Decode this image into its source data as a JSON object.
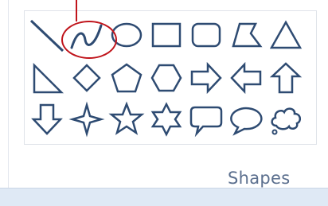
{
  "group": {
    "label": "Shapes"
  },
  "colors": {
    "stroke": "#2e4b72",
    "callout": "#c0141b",
    "label": "#5b6f8e"
  },
  "shapes": [
    {
      "name": "line",
      "selected": false
    },
    {
      "name": "curve",
      "selected": true
    },
    {
      "name": "oval",
      "selected": false
    },
    {
      "name": "rectangle",
      "selected": false
    },
    {
      "name": "rounded-rectangle",
      "selected": false
    },
    {
      "name": "polygon",
      "selected": false
    },
    {
      "name": "triangle",
      "selected": false
    },
    {
      "name": "right-triangle",
      "selected": false
    },
    {
      "name": "diamond",
      "selected": false
    },
    {
      "name": "pentagon",
      "selected": false
    },
    {
      "name": "hexagon",
      "selected": false
    },
    {
      "name": "right-arrow",
      "selected": false
    },
    {
      "name": "left-arrow",
      "selected": false
    },
    {
      "name": "up-arrow",
      "selected": false
    },
    {
      "name": "down-arrow",
      "selected": false
    },
    {
      "name": "four-point-star",
      "selected": false
    },
    {
      "name": "five-point-star",
      "selected": false
    },
    {
      "name": "six-point-star",
      "selected": false
    },
    {
      "name": "rounded-rectangular-callout",
      "selected": false
    },
    {
      "name": "oval-callout",
      "selected": false
    },
    {
      "name": "cloud-callout",
      "selected": false
    }
  ]
}
